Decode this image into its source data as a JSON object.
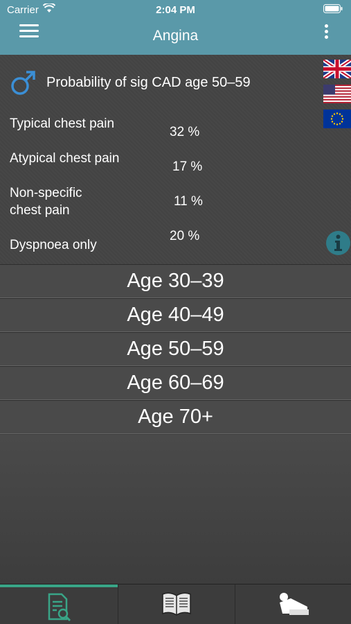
{
  "status": {
    "carrier": "Carrier",
    "time": "2:04 PM"
  },
  "nav": {
    "title": "Angina"
  },
  "results": {
    "header": "Probability of sig CAD age 50–59",
    "rows": [
      {
        "label": "Typical chest pain",
        "value": "32 %"
      },
      {
        "label": "Atypical chest pain",
        "value": "17 %"
      },
      {
        "label": "Non-specific",
        "label2": "chest pain",
        "value": "11 %"
      },
      {
        "label": "Dyspnoea only",
        "value": "20 %"
      }
    ]
  },
  "ages": [
    "Age 30–39",
    "Age 40–49",
    "Age 50–59",
    "Age 60–69",
    "Age 70+"
  ],
  "icons": {
    "menu": "hamburger-icon",
    "more": "more-vertical-icon",
    "male": "male-symbol-icon",
    "info": "info-icon",
    "tab1": "document-search-icon",
    "tab2": "open-book-icon",
    "tab3": "patient-bed-icon"
  },
  "colors": {
    "nav": "#5a99a9",
    "accent": "#39a587",
    "male": "#3b8fd6",
    "info": "#2f7c89"
  }
}
